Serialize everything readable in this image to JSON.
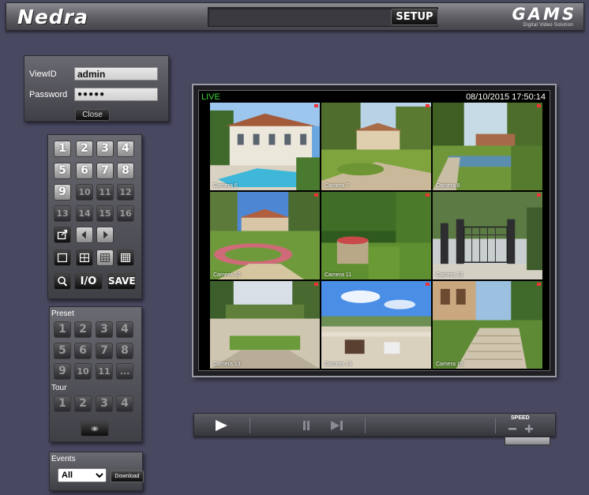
{
  "header": {
    "brand": "Nedra",
    "setup_label": "SETUP",
    "logo": "GAMS",
    "logo_sub": "Digital Video Solution"
  },
  "login": {
    "viewid_label": "ViewID",
    "viewid_value": "admin",
    "password_label": "Password",
    "password_value": "●●●●●",
    "close_label": "Close"
  },
  "control": {
    "channels": [
      "1",
      "2",
      "3",
      "4",
      "5",
      "6",
      "7",
      "8",
      "9",
      "10",
      "11",
      "12",
      "13",
      "14",
      "15",
      "16"
    ],
    "io_label": "I/O",
    "save_label": "SAVE"
  },
  "preset": {
    "title": "Preset",
    "buttons": [
      "1",
      "2",
      "3",
      "4",
      "5",
      "6",
      "7",
      "8",
      "9",
      "10",
      "11",
      "..."
    ],
    "tour_title": "Tour",
    "tour_buttons": [
      "1",
      "2",
      "3",
      "4"
    ]
  },
  "events": {
    "title": "Events",
    "selected": "All",
    "download_label": "Download"
  },
  "video": {
    "status": "LIVE",
    "timestamp": "08/10/2015 17:50:14",
    "cameras": [
      "Camera 6",
      "Camera 7",
      "Camera 8",
      "Camera 10",
      "Camera 11",
      "Camera 12",
      "Camera 13",
      "Camera 14",
      "Camera 15"
    ]
  },
  "playback": {
    "speed_label": "SPEED"
  }
}
